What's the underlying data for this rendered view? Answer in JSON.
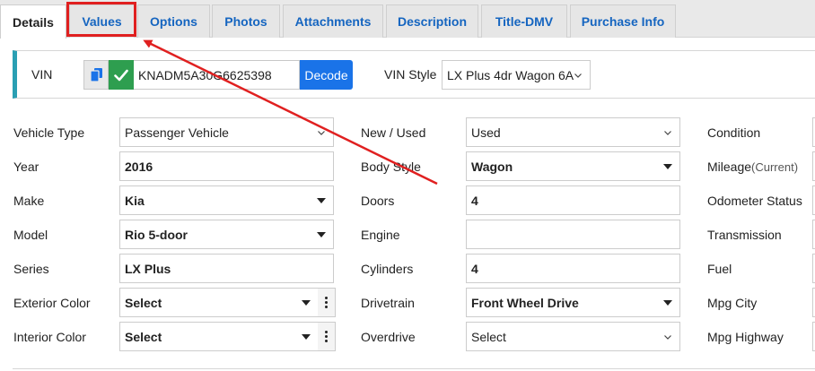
{
  "tabs": [
    {
      "label": "Details",
      "active": true
    },
    {
      "label": "Values"
    },
    {
      "label": "Options"
    },
    {
      "label": "Photos"
    },
    {
      "label": "Attachments"
    },
    {
      "label": "Description"
    },
    {
      "label": "Title-DMV"
    },
    {
      "label": "Purchase Info"
    }
  ],
  "vin": {
    "label": "VIN",
    "value": "KNADM5A30G6625398",
    "decode_label": "Decode",
    "style_label": "VIN Style",
    "style_value": "LX Plus 4dr Wagon 6A"
  },
  "form": {
    "vehicle_type": {
      "label": "Vehicle Type",
      "value": "Passenger Vehicle"
    },
    "year": {
      "label": "Year",
      "value": "2016"
    },
    "make": {
      "label": "Make",
      "value": "Kia"
    },
    "model": {
      "label": "Model",
      "value": "Rio 5-door"
    },
    "series": {
      "label": "Series",
      "value": "LX Plus"
    },
    "exterior_color": {
      "label": "Exterior Color",
      "value": "Select"
    },
    "interior_color": {
      "label": "Interior Color",
      "value": "Select"
    },
    "new_used": {
      "label": "New / Used",
      "value": "Used"
    },
    "body_style": {
      "label": "Body Style",
      "value": "Wagon"
    },
    "doors": {
      "label": "Doors",
      "value": "4"
    },
    "engine": {
      "label": "Engine",
      "value": ""
    },
    "cylinders": {
      "label": "Cylinders",
      "value": "4"
    },
    "drivetrain": {
      "label": "Drivetrain",
      "value": "Front Wheel Drive"
    },
    "overdrive": {
      "label": "Overdrive",
      "value": "Select"
    },
    "condition": {
      "label": "Condition"
    },
    "mileage": {
      "label": "Mileage",
      "sub": "(Current)"
    },
    "odometer_status": {
      "label": "Odometer Status"
    },
    "transmission": {
      "label": "Transmission"
    },
    "fuel": {
      "label": "Fuel"
    },
    "mpg_city": {
      "label": "Mpg City"
    },
    "mpg_highway": {
      "label": "Mpg Highway"
    }
  },
  "colors": {
    "accent": "#1565c0",
    "decode": "#1a73e8",
    "check": "#2e9e4f",
    "annotation": "#e02020",
    "panel_bar": "#2a9fb3"
  },
  "icons": {
    "copy": "copy-icon",
    "check": "check-icon",
    "chevron": "chevron-down-icon",
    "caret": "caret-down-icon",
    "kebab": "kebab-icon"
  }
}
